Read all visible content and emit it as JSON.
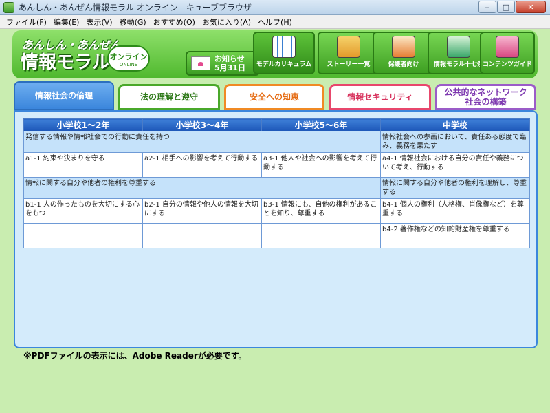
{
  "window": {
    "title": "あんしん・あんぜん情報モラル オンライン - キューブブラウザ",
    "minimize": "‒",
    "maximize": "□",
    "close": "✕"
  },
  "menu": [
    "ファイル(F)",
    "編集(E)",
    "表示(V)",
    "移動(G)",
    "おすすめ(O)",
    "お気に入り(A)",
    "ヘルプ(H)"
  ],
  "header": {
    "logo_top": "あんしん・あんぜん",
    "logo_main": "情報モラル",
    "badge_main": "オンライン",
    "badge_sub": "ONLINE",
    "notice_line1": "お知らせ",
    "notice_line2": "5月31日"
  },
  "nav": [
    {
      "label": "モデルカリキュラム",
      "icon": "calendar-icon"
    },
    {
      "label": "ストーリー一覧",
      "icon": "story-icon"
    },
    {
      "label": "保護者向け",
      "icon": "guardian-icon"
    },
    {
      "label": "情報モラル十七条",
      "icon": "scroll-icon"
    },
    {
      "label": "コンテンツガイド",
      "icon": "book-icon"
    }
  ],
  "tabs": {
    "ethics": "情報社会の倫理",
    "law": "法の理解と遵守",
    "safety": "安全への知恵",
    "security": "情報セキュリティ",
    "network_line1": "公共的なネットワーク",
    "network_line2": "社会の構築"
  },
  "table": {
    "headers": [
      "小学校1～2年",
      "小学校3～4年",
      "小学校5～6年",
      "中学校"
    ],
    "section_a": {
      "elem": "発信する情報や情報社会での行動に責任を持つ",
      "jhs": "情報社会への参画において、責任ある態度で臨み、義務を果たす"
    },
    "row_a": [
      "a1-1 約束や決まりを守る",
      "a2-1 相手への影響を考えて行動する",
      "a3-1 他人や社会への影響を考えて行動する",
      "a4-1 情報社会における自分の責任や義務について考え、行動する"
    ],
    "section_b": {
      "elem": "情報に関する自分や他者の権利を尊重する",
      "jhs": "情報に関する自分や他者の権利を理解し、尊重する"
    },
    "row_b": [
      "b1-1 人の作ったものを大切にする心をもつ",
      "b2-1 自分の情報や他人の情報を大切にする",
      "b3-1 情報にも、自他の権利があることを知り、尊重する",
      "b4-1 個人の権利（人格権、肖像権など）を尊重する"
    ],
    "row_b2": [
      "",
      "",
      "",
      "b4-2 著作権などの知的財産権を尊重する"
    ]
  },
  "footnote": "※PDFファイルの表示には、Adobe Readerが必要です。"
}
